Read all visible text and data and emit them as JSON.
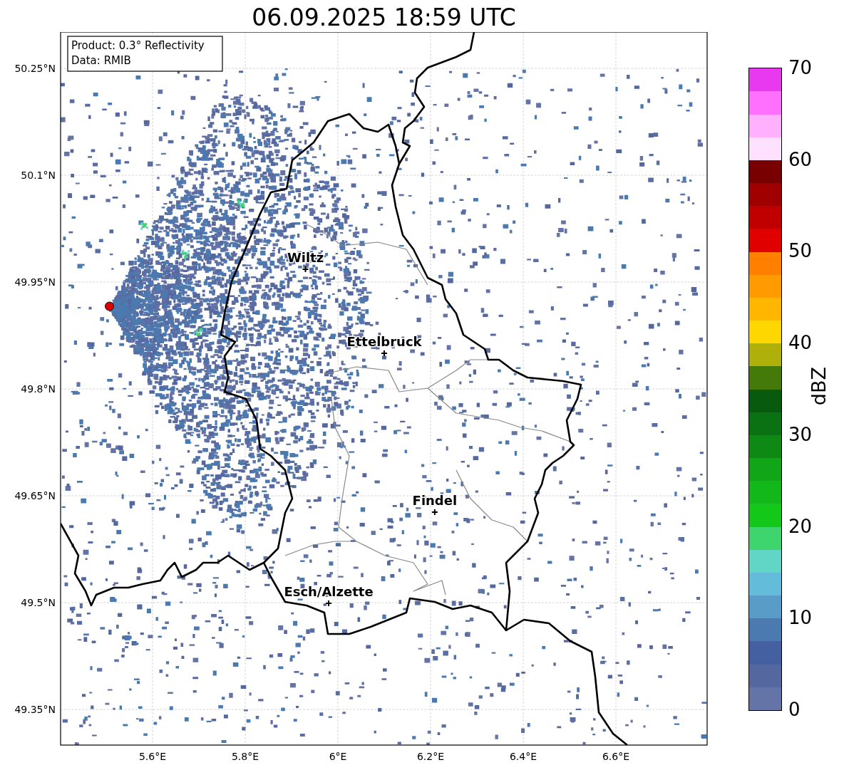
{
  "title": "06.09.2025 18:59 UTC",
  "info_box": [
    "Product: 0.3° Reflectivity",
    "Data: RMIB"
  ],
  "map": {
    "lat_ticks": [
      "50.25°N",
      "50.1°N",
      "49.95°N",
      "49.8°N",
      "49.65°N",
      "49.5°N",
      "49.35°N"
    ],
    "lon_ticks": [
      "5.6°E",
      "5.8°E",
      "6°E",
      "6.2°E",
      "6.4°E",
      "6.6°E"
    ],
    "cities": [
      "Wiltz",
      "Ettelbruck",
      "Findel",
      "Esch/Alzette"
    ]
  },
  "colorbar": {
    "label": "dBZ",
    "ticks": [
      "70",
      "60",
      "50",
      "40",
      "30",
      "20",
      "10",
      "0"
    ]
  }
}
